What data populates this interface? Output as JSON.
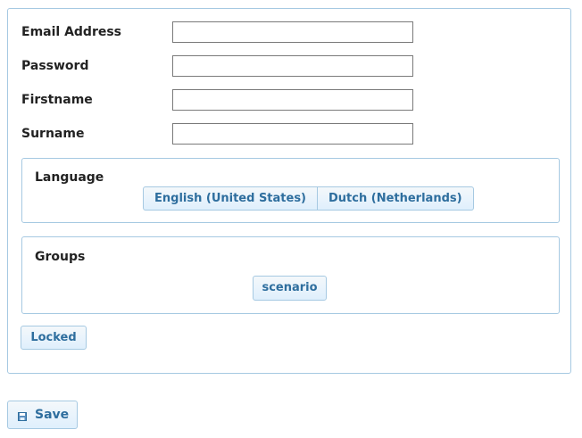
{
  "form": {
    "fields": [
      {
        "label": "Email Address",
        "value": "",
        "placeholder": ""
      },
      {
        "label": "Password",
        "value": "",
        "placeholder": ""
      },
      {
        "label": "Firstname",
        "value": "",
        "placeholder": ""
      },
      {
        "label": "Surname",
        "value": "",
        "placeholder": ""
      }
    ],
    "language": {
      "title": "Language",
      "options": [
        "English (United States)",
        "Dutch (Netherlands)"
      ]
    },
    "groups": {
      "title": "Groups",
      "options": [
        "scenario"
      ]
    },
    "locked_label": "Locked"
  },
  "actions": {
    "save_label": "Save",
    "save_icon": "floppy-disk-icon"
  },
  "colors": {
    "accent_text": "#2e6e9e",
    "border": "#a6c9e2",
    "button_top": "#f4f8fb",
    "button_bottom": "#dfeffc"
  }
}
